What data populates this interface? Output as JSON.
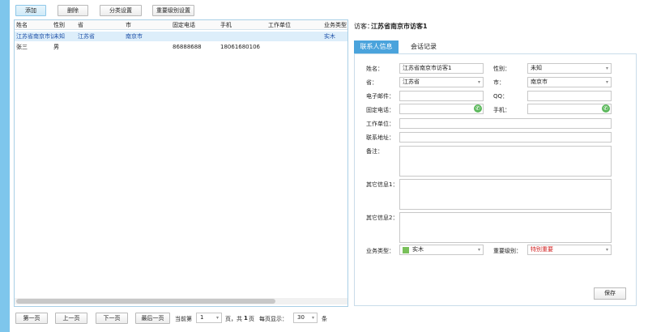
{
  "toolbar": {
    "add_label": "添加",
    "delete_label": "删除",
    "category_label": "分类设置",
    "importance_label": "重要级别设置"
  },
  "grid": {
    "columns": [
      "姓名",
      "性别",
      "省",
      "市",
      "固定电话",
      "手机",
      "工作单位",
      "业务类型"
    ],
    "rows": [
      [
        "江苏省南京市访客1",
        "未知",
        "江苏省",
        "南京市",
        "",
        "",
        "",
        "实木"
      ],
      [
        "张三",
        "男",
        "",
        "",
        "86888688",
        "18061680106",
        "",
        ""
      ]
    ],
    "selected_row": 0
  },
  "pager": {
    "first_label": "第一页",
    "prev_label": "上一页",
    "next_label": "下一页",
    "last_label": "最后一页",
    "current_label": "当前第",
    "current_page": "1",
    "pages_text_prefix": "页，共",
    "total_pages": "1",
    "pages_text_suffix": "页",
    "per_page_label": "每页显示：",
    "per_page": "30",
    "unit": "条"
  },
  "detail": {
    "title_label": "访客：",
    "title_value": "江苏省南京市访客1",
    "tabs": [
      "联系人信息",
      "会话记录"
    ],
    "fields": {
      "name_label": "姓名：",
      "name_value": "江苏省南京市访客1",
      "gender_label": "性别：",
      "gender_value": "未知",
      "province_label": "省：",
      "province_value": "江苏省",
      "city_label": "市：",
      "city_value": "南京市",
      "email_label": "电子邮件：",
      "email_value": "",
      "qq_label": "QQ：",
      "qq_value": "",
      "phone_label": "固定电话：",
      "phone_value": "",
      "mobile_label": "手机：",
      "mobile_value": "",
      "company_label": "工作单位：",
      "company_value": "",
      "address_label": "联系地址：",
      "address_value": "",
      "remark_label": "备注：",
      "other1_label": "其它信息1：",
      "other2_label": "其它信息2：",
      "business_label": "业务类型：",
      "business_value": "实木",
      "importance_label": "重要级别：",
      "importance_value": "特别重要"
    },
    "save_label": "保存"
  },
  "colors": {
    "accent": "#4aa3dc",
    "selected_text": "#1c4fa7",
    "importance_text": "#d02020",
    "business_swatch": "#79c05a"
  },
  "icons": [
    "phone-icon",
    "chevron-down-icon"
  ]
}
